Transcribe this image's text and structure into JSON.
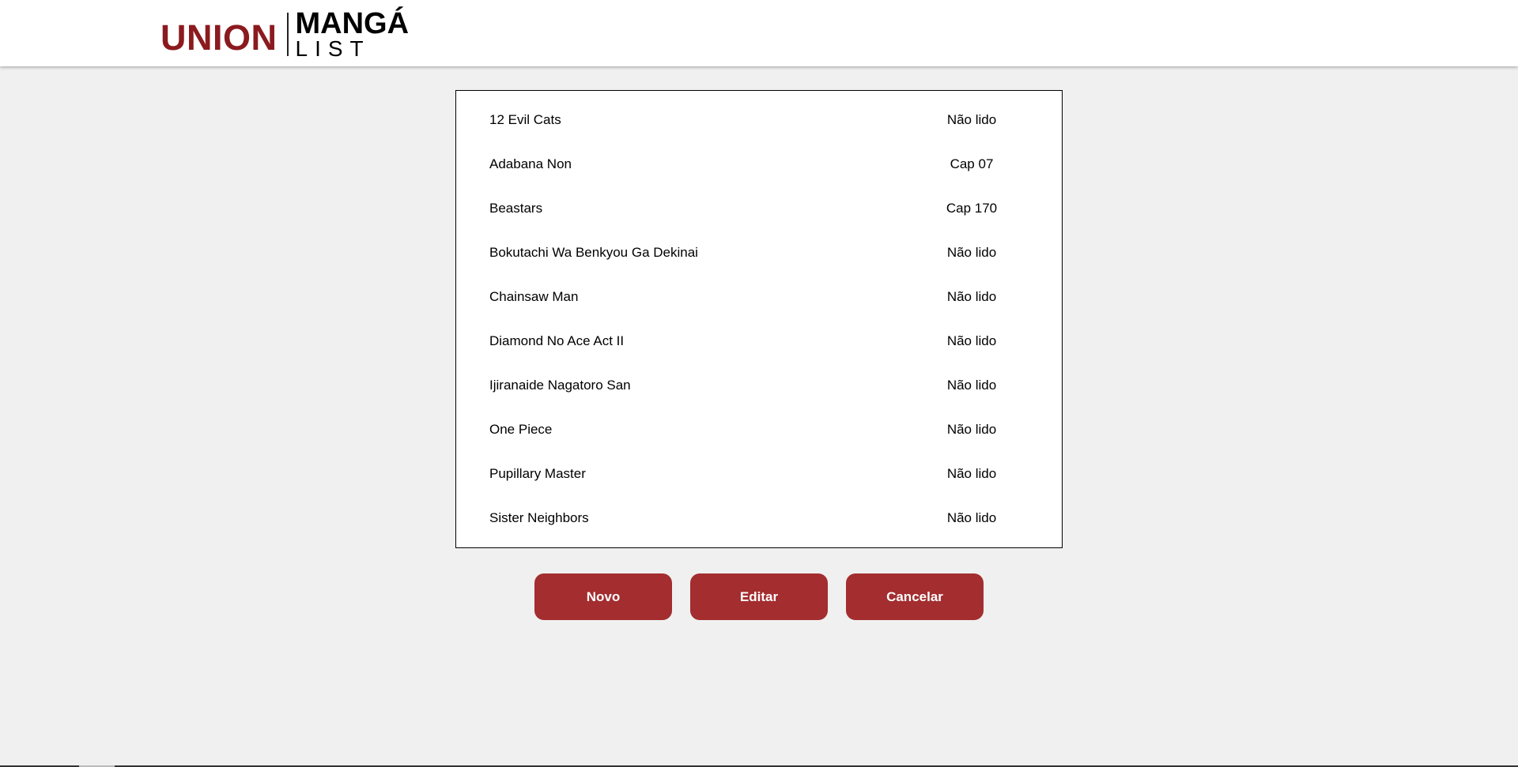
{
  "header": {
    "logo_union": "UNION",
    "logo_manga": "MANGÁ",
    "logo_list": "LIST"
  },
  "manga_list": [
    {
      "title": "12 Evil Cats",
      "status": "Não lido"
    },
    {
      "title": "Adabana Non",
      "status": "Cap 07"
    },
    {
      "title": "Beastars",
      "status": "Cap 170"
    },
    {
      "title": "Bokutachi Wa Benkyou Ga Dekinai",
      "status": "Não lido"
    },
    {
      "title": "Chainsaw Man",
      "status": "Não lido"
    },
    {
      "title": "Diamond No Ace Act II",
      "status": "Não lido"
    },
    {
      "title": "Ijiranaide Nagatoro San",
      "status": "Não lido"
    },
    {
      "title": "One Piece",
      "status": "Não lido"
    },
    {
      "title": "Pupillary Master",
      "status": "Não lido"
    },
    {
      "title": "Sister Neighbors",
      "status": "Não lido"
    }
  ],
  "buttons": {
    "novo": "Novo",
    "editar": "Editar",
    "cancelar": "Cancelar"
  },
  "colors": {
    "brand_red": "#8b1a1f",
    "button_red": "#a32d2f",
    "background": "#f0f0f0"
  }
}
